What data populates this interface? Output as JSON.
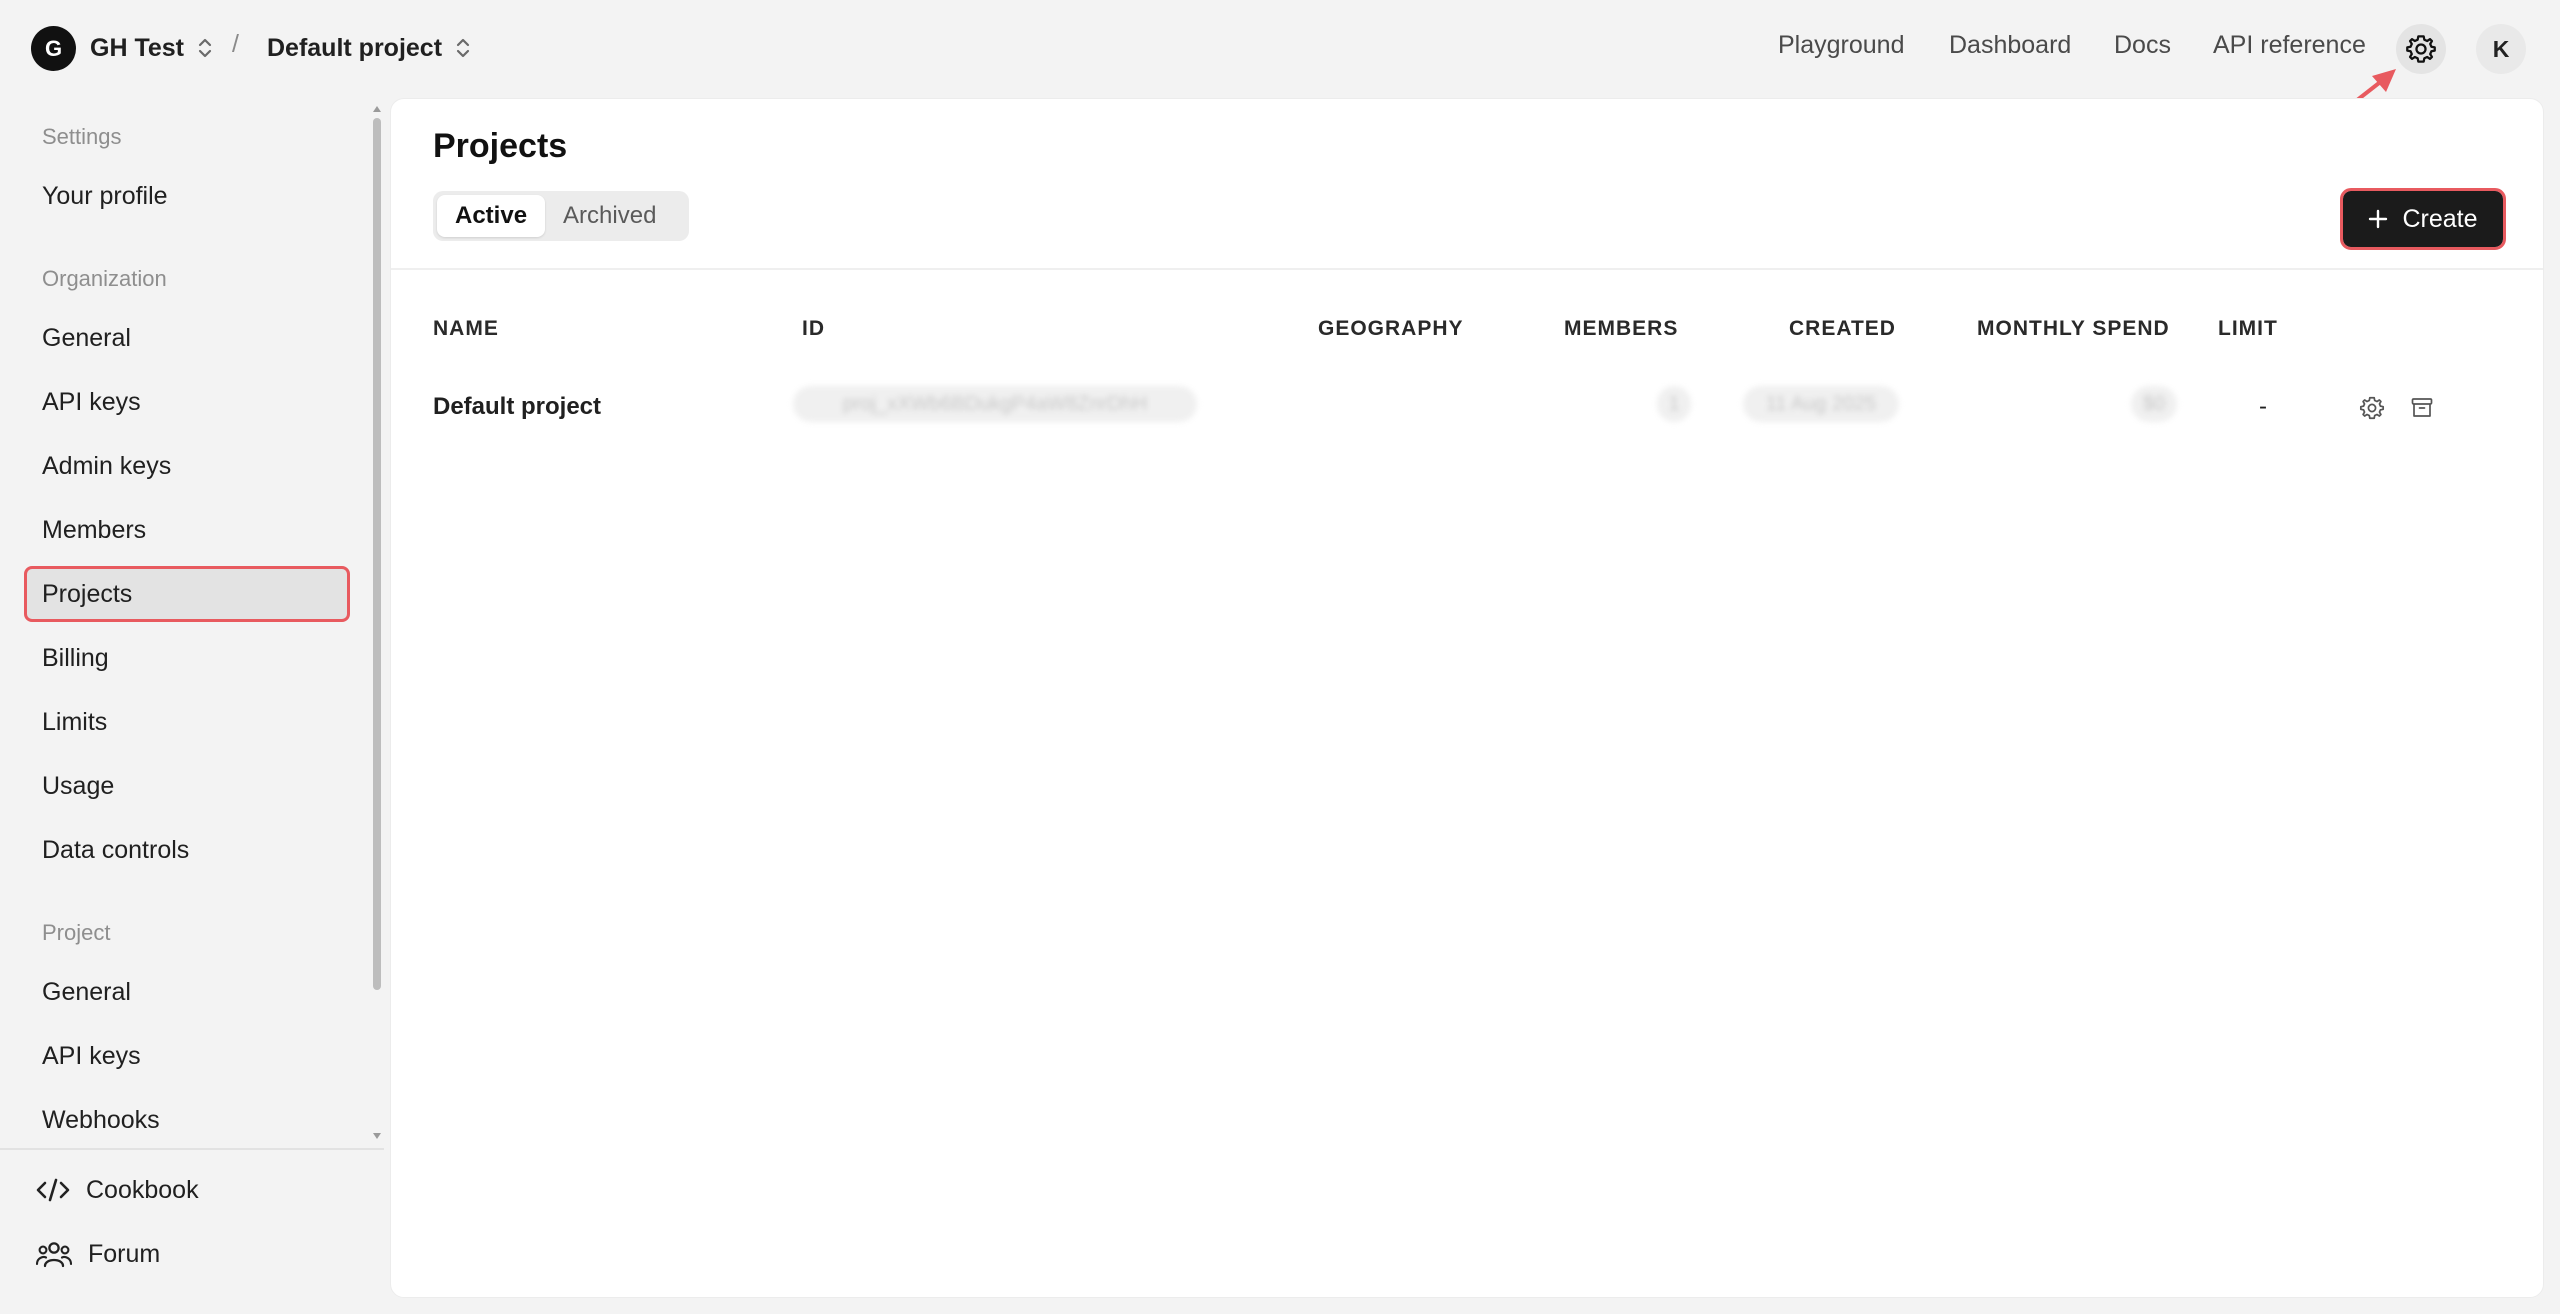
{
  "topbar": {
    "org_initial": "G",
    "org_name": "GH Test",
    "separator": "/",
    "project_name": "Default project",
    "nav": [
      "Playground",
      "Dashboard",
      "Docs",
      "API reference"
    ],
    "user_initial": "K"
  },
  "sidebar": {
    "settings_heading": "Settings",
    "your_profile": "Your profile",
    "organization_heading": "Organization",
    "org_items": [
      "General",
      "API keys",
      "Admin keys",
      "Members",
      "Projects",
      "Billing",
      "Limits",
      "Usage",
      "Data controls"
    ],
    "project_heading": "Project",
    "project_items": [
      "General",
      "API keys",
      "Webhooks"
    ],
    "footer": [
      "Cookbook",
      "Forum"
    ]
  },
  "main": {
    "title": "Projects",
    "tabs": [
      "Active",
      "Archived"
    ],
    "create_label": "Create",
    "columns": [
      "NAME",
      "ID",
      "GEOGRAPHY",
      "MEMBERS",
      "CREATED",
      "MONTHLY SPEND",
      "LIMIT"
    ],
    "rows": [
      {
        "name": "Default project",
        "id": "proj_xXWb6BDukgP4aW8ZnrDhH",
        "geography": "",
        "members": "1",
        "created": "11 Aug 2025",
        "monthly_spend": "$0",
        "limit": "-"
      }
    ]
  },
  "colors": {
    "accent_annotation": "#e85a5f",
    "create_bg": "#1b1b1b",
    "page_bg": "#f3f3f3",
    "panel_bg": "#ffffff"
  }
}
